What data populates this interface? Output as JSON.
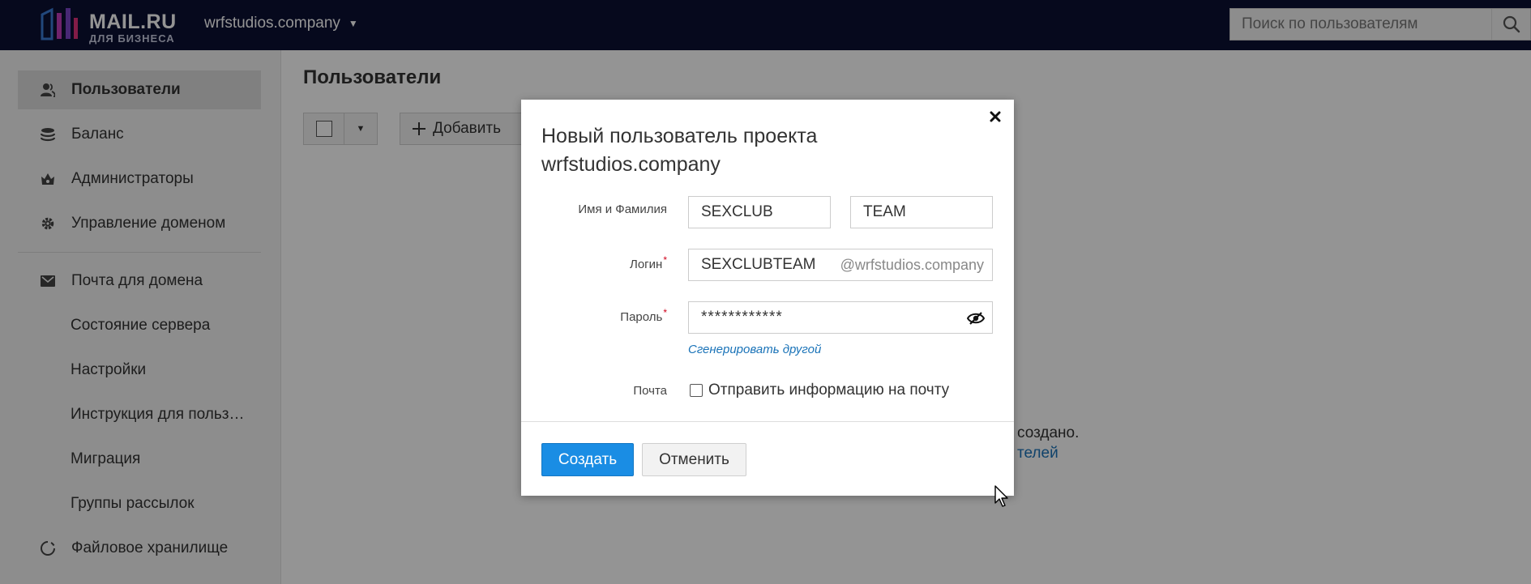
{
  "header": {
    "logo_text": "MAIL.RU",
    "logo_sub": "ДЛЯ БИЗНЕСА",
    "domain": "wrfstudios.company",
    "search_placeholder": "Поиск по пользователям"
  },
  "sidebar": {
    "items": [
      {
        "label": "Пользователи",
        "icon": "users-icon",
        "active": true
      },
      {
        "label": "Баланс",
        "icon": "coins-icon"
      },
      {
        "label": "Администраторы",
        "icon": "crown-icon"
      },
      {
        "label": "Управление доменом",
        "icon": "gear-icon"
      },
      {
        "label": "Почта для домена",
        "icon": "mail-icon"
      },
      {
        "label": "Состояние сервера"
      },
      {
        "label": "Настройки"
      },
      {
        "label": "Инструкция для польз…"
      },
      {
        "label": "Миграция"
      },
      {
        "label": "Группы рассылок"
      },
      {
        "label": "Файловое хранилище",
        "icon": "cloud-icon"
      }
    ]
  },
  "main": {
    "title": "Пользователи",
    "add_label": "Добавить",
    "empty_text_tail": "создано.",
    "empty_link_tail": "телей"
  },
  "modal": {
    "title": "Новый пользователь проекта wrfstudios.company",
    "name_label": "Имя и Фамилия",
    "first_name": "SEXCLUB",
    "last_name": "TEAM",
    "login_label": "Логин",
    "login_value": "SEXCLUBTEAM",
    "login_suffix": "@wrfstudios.company",
    "password_label": "Пароль",
    "password_value": "************",
    "generate_link": "Сгенерировать другой",
    "mail_label": "Почта",
    "mail_checkbox_label": "Отправить информацию на почту",
    "mail_checked": false,
    "create_button": "Создать",
    "cancel_button": "Отменить"
  },
  "colors": {
    "header_bg": "#0c1033",
    "primary": "#1a8de4",
    "link": "#1a73b8",
    "required": "#d0021b"
  }
}
